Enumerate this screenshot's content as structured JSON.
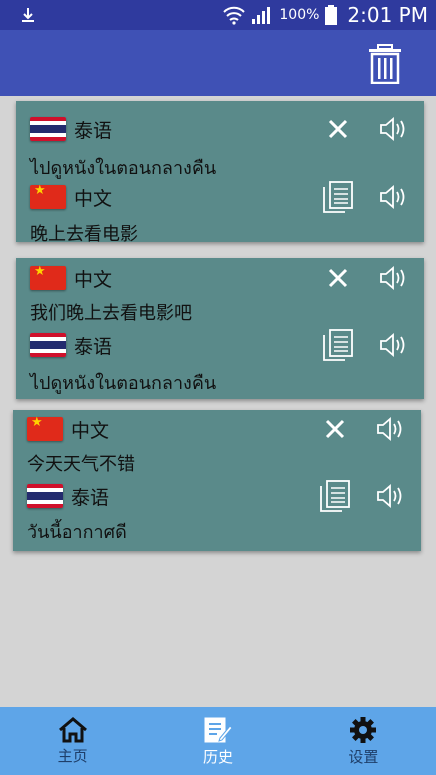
{
  "status_bar": {
    "battery": "100%",
    "time": "2:01 PM"
  },
  "app_bar": {
    "actions": [
      "trash-icon"
    ]
  },
  "cards": [
    {
      "source_lang": "泰语",
      "source_flag": "thailand",
      "source_text": "ไปดูหนังในตอนกลางคืน",
      "target_lang": "中文",
      "target_flag": "china",
      "target_text": "晚上去看电影"
    },
    {
      "source_lang": "中文",
      "source_flag": "china",
      "source_text": "我们晚上去看电影吧",
      "target_lang": "泰语",
      "target_flag": "thailand",
      "target_text": "ไปดูหนังในตอนกลางคืน"
    },
    {
      "source_lang": "中文",
      "source_flag": "china",
      "source_text": "今天天气不错",
      "target_lang": "泰语",
      "target_flag": "thailand",
      "target_text": "วันนี้อากาศดี"
    }
  ],
  "bottom_nav": [
    {
      "label": "主页",
      "icon": "home-icon",
      "active": false
    },
    {
      "label": "历史",
      "icon": "history-icon",
      "active": true
    },
    {
      "label": "设置",
      "icon": "settings-icon",
      "active": false
    }
  ],
  "colors": {
    "status_bar": "#2f3a9e",
    "app_bar": "#3f51b5",
    "card": "#5a8a8a",
    "background": "#d4d4d4",
    "bottom_nav": "#5ea5e8"
  }
}
